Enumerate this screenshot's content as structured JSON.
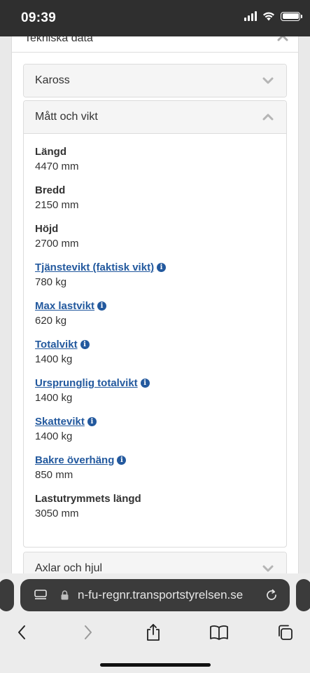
{
  "status_bar": {
    "time": "09:39"
  },
  "outer": {
    "title": "Tekniska data"
  },
  "panels": {
    "kaross": {
      "title": "Kaross"
    },
    "matt": {
      "title": "Mått och vikt"
    },
    "axlar": {
      "title": "Axlar och hjul"
    }
  },
  "specs": [
    {
      "label": "Längd",
      "value": "4470 mm",
      "link": false
    },
    {
      "label": "Bredd",
      "value": "2150 mm",
      "link": false
    },
    {
      "label": "Höjd",
      "value": "2700 mm",
      "link": false
    },
    {
      "label": "Tjänstevikt (faktisk vikt)",
      "value": "780 kg",
      "link": true
    },
    {
      "label": "Max lastvikt",
      "value": "620 kg",
      "link": true
    },
    {
      "label": "Totalvikt",
      "value": "1400 kg",
      "link": true
    },
    {
      "label": "Ursprunglig totalvikt",
      "value": "1400 kg",
      "link": true
    },
    {
      "label": "Skattevikt",
      "value": "1400 kg",
      "link": true
    },
    {
      "label": "Bakre överhäng",
      "value": "850 mm",
      "link": true
    },
    {
      "label": "Lastutrymmets längd",
      "value": "3050 mm",
      "link": false
    }
  ],
  "browser": {
    "url": "n-fu-regnr.transportstyrelsen.se"
  },
  "colors": {
    "link": "#23599e",
    "panel_header": "#f5f5f5",
    "chrome": "#3b3b3b"
  }
}
